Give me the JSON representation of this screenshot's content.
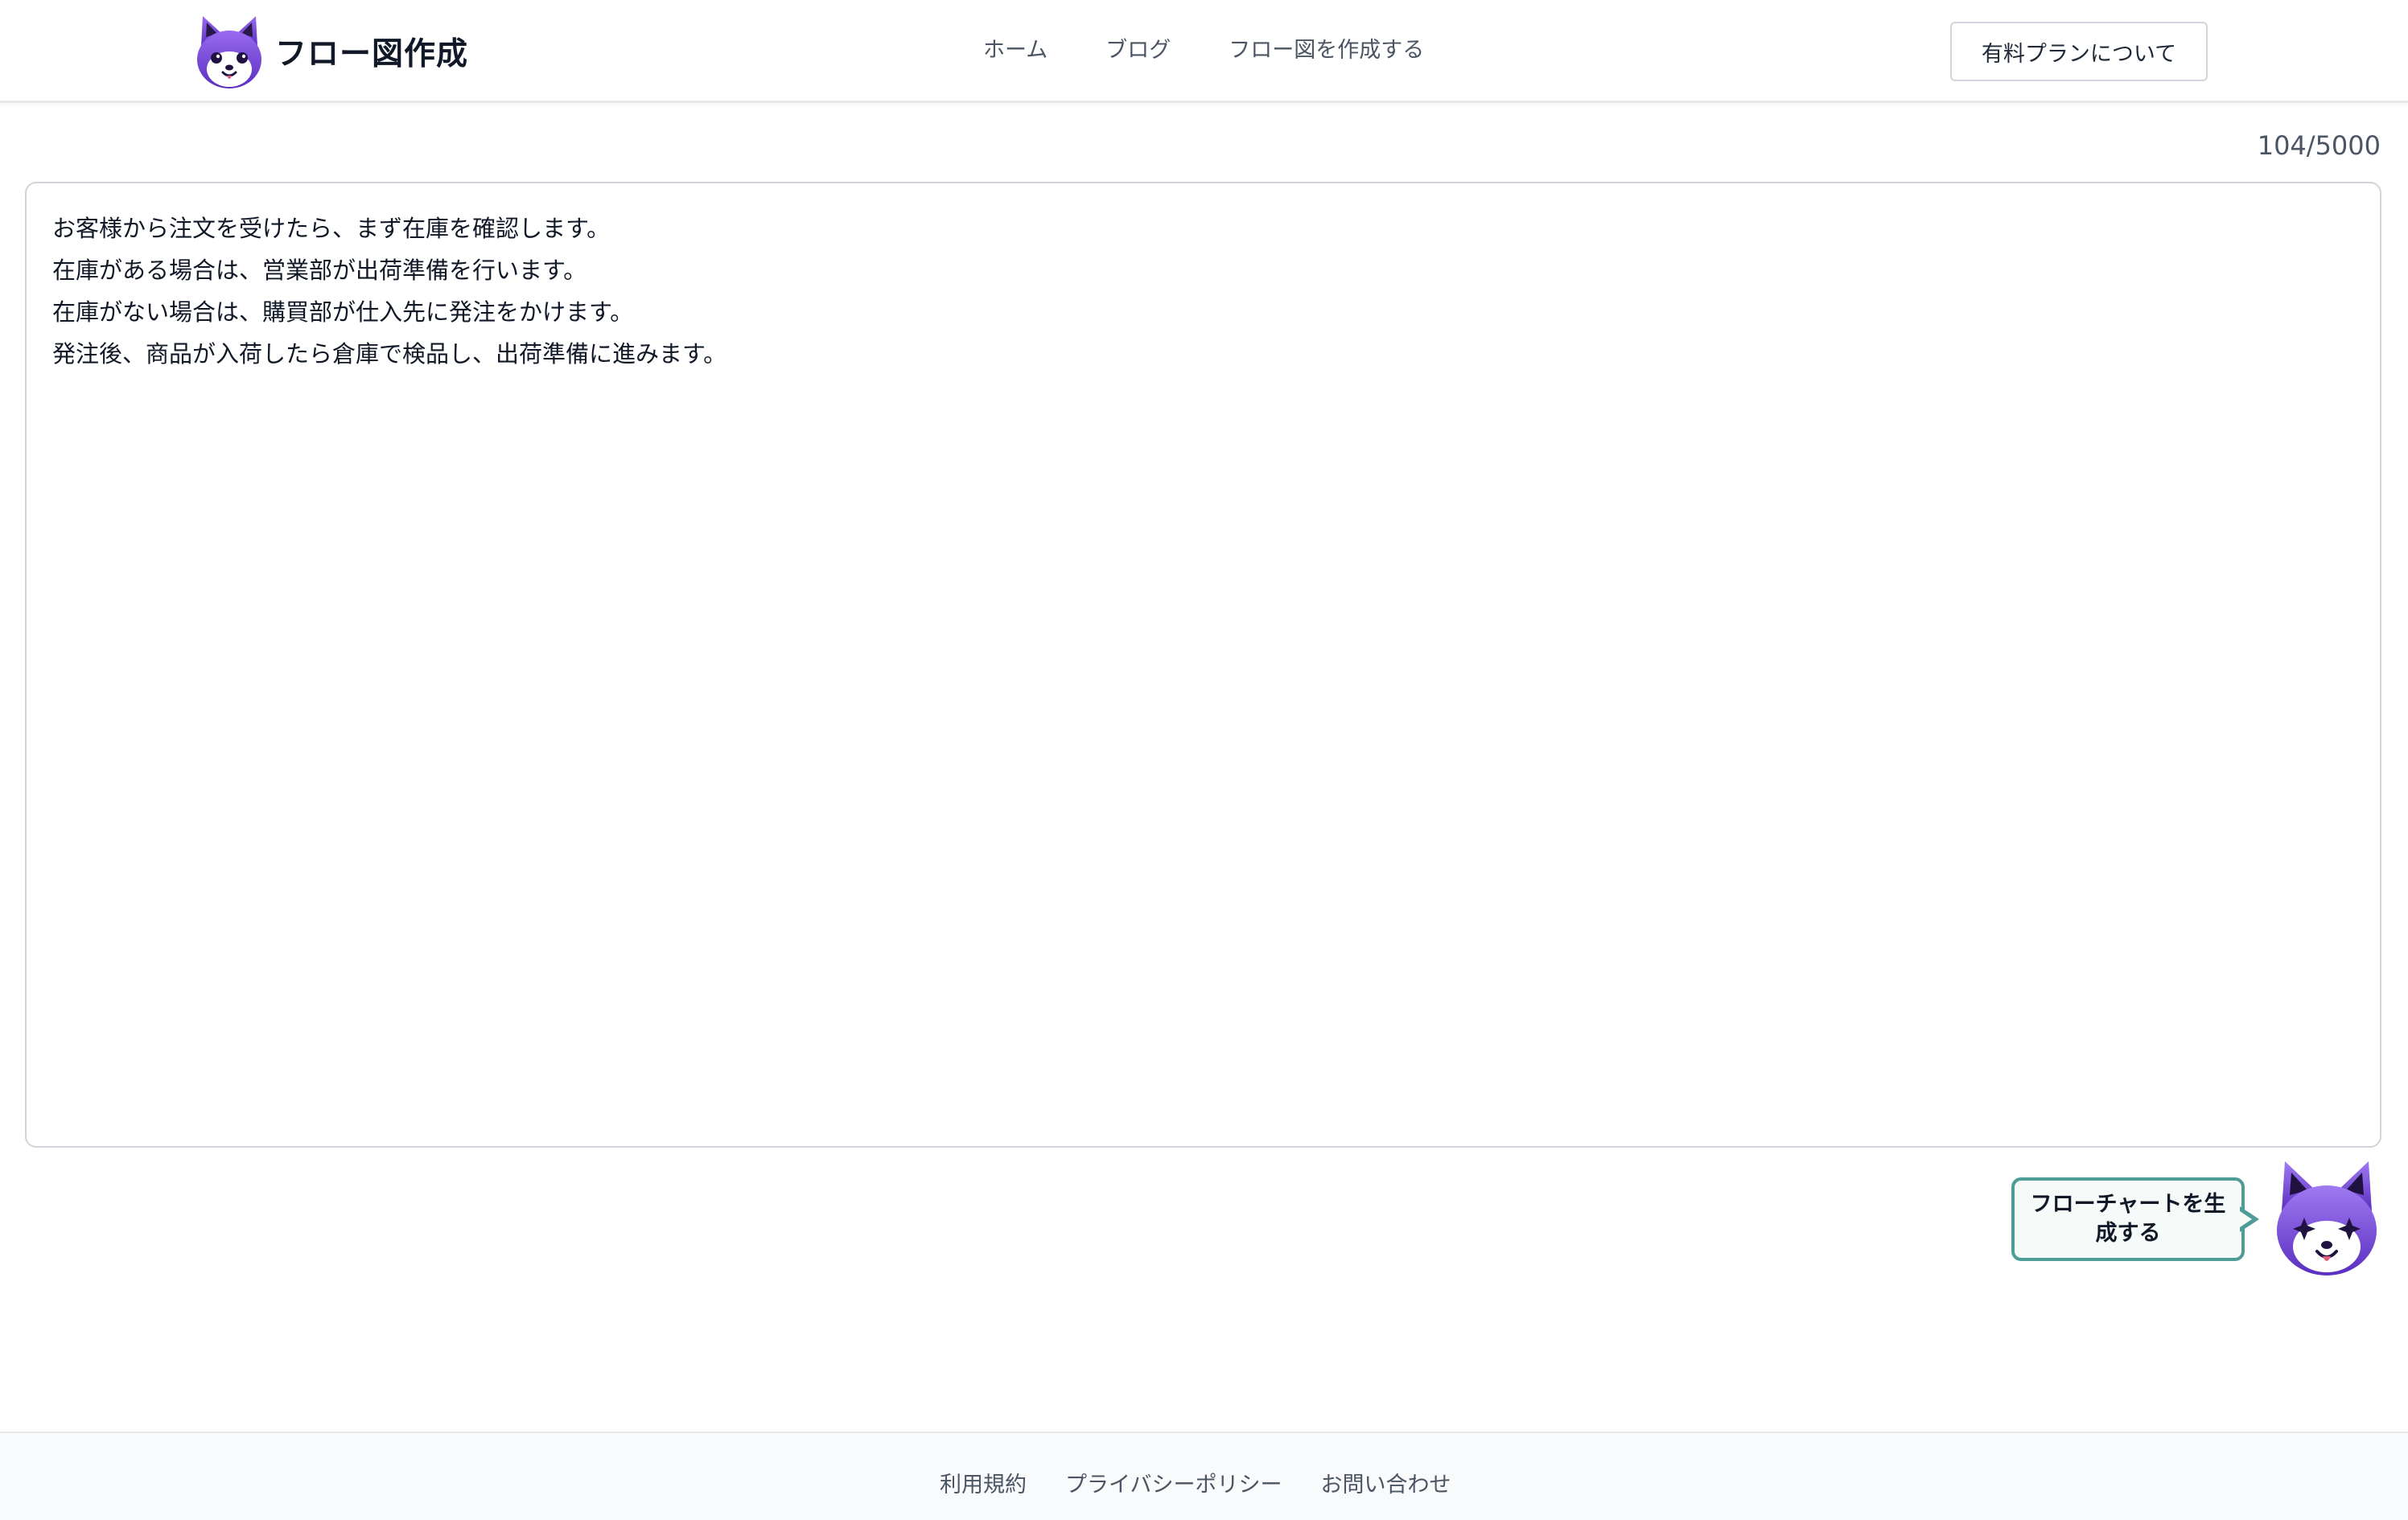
{
  "header": {
    "logo_icon": "fox-mascot-icon",
    "brand_name": "フロー図作成",
    "nav": {
      "home": "ホーム",
      "blog": "ブログ",
      "create": "フロー図を作成する"
    },
    "plan_button": "有料プランについて"
  },
  "editor": {
    "char_count": "104/5000",
    "text": "お客様から注文を受けたら、まず在庫を確認します。\n在庫がある場合は、営業部が出荷準備を行います。\n在庫がない場合は、購買部が仕入先に発注をかけます。\n発注後、商品が入荷したら倉庫で検品し、出荷準備に進みます。"
  },
  "generate": {
    "label": "フローチャートを生成する",
    "mascot_icon": "sparkle-eyed-fox-mascot-icon"
  },
  "footer": {
    "terms": "利用規約",
    "privacy": "プライバシーポリシー",
    "contact": "お問い合わせ"
  },
  "colors": {
    "brand_purple": "#7c4ddb",
    "bubble_border": "#4e9c95",
    "bubble_bg": "#f6fbfa"
  }
}
